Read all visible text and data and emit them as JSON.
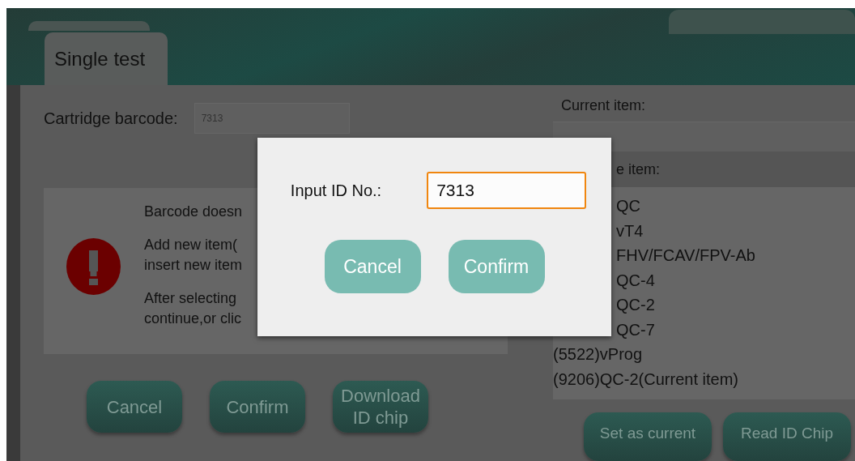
{
  "tabs": [
    {
      "label": "Single test",
      "selected": true
    }
  ],
  "cartridge": {
    "label": "Cartridge barcode:",
    "value": "7313"
  },
  "message": {
    "lines": [
      "Barcode doesn",
      "Add new item(",
      "insert new item",
      "After selecting",
      "continue,or clic"
    ]
  },
  "left_buttons": [
    "Cancel",
    "Confirm",
    "Download\nID chip"
  ],
  "current_item": {
    "label": "Current item:"
  },
  "item_list": {
    "header": "e item:",
    "items": [
      {
        "text": "QC",
        "kind": "covered"
      },
      {
        "text": "vT4",
        "kind": "covered"
      },
      {
        "text": "FHV/FCAV/FPV-Ab",
        "kind": "covered"
      },
      {
        "text": "QC-4",
        "kind": "covered"
      },
      {
        "text": "QC-2",
        "kind": "covered"
      },
      {
        "text": "QC-7",
        "kind": "covered"
      },
      {
        "text": "(5522)vProg",
        "kind": "full"
      },
      {
        "text": "(9206)QC-2(Current item)",
        "kind": "full"
      }
    ]
  },
  "right_buttons": [
    "Set as current",
    "Read ID Chip"
  ],
  "dialog": {
    "label": "Input ID No.:",
    "value": "7313",
    "buttons": [
      "Cancel",
      "Confirm"
    ]
  }
}
